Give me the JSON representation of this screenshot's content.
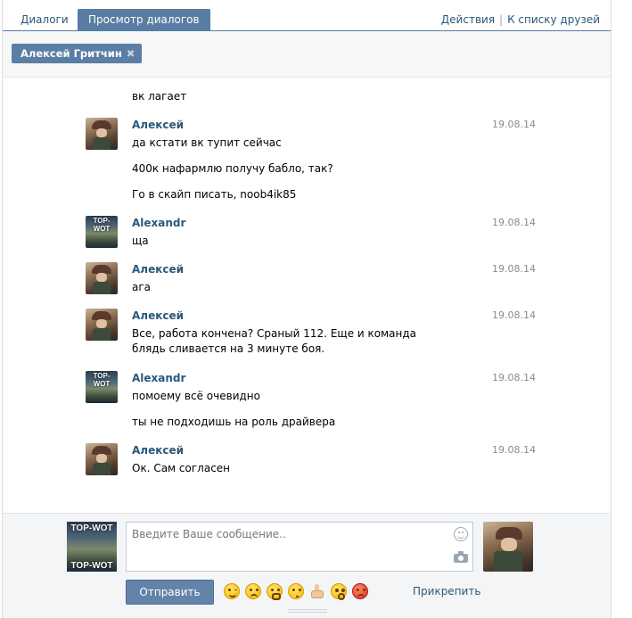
{
  "tabs": {
    "dialogs": "Диалоги",
    "view": "Просмотр диалогов"
  },
  "links": {
    "actions": "Действия",
    "separator": "|",
    "friends": "К списку друзей"
  },
  "filter": {
    "name": "Алексей Гритчин",
    "remove_icon": "✖"
  },
  "history": [
    {
      "author": "",
      "date": "",
      "avatar": "",
      "lines": [
        "вк лагает"
      ]
    },
    {
      "author": "Алексей",
      "date": "19.08.14",
      "avatar": "alexey",
      "lines": [
        "да кстати вк тупит сейчас",
        "400к нафармлю получу бабло, так?",
        "Го в скайп писать, noob4ik85"
      ]
    },
    {
      "author": "Alexandr",
      "date": "19.08.14",
      "avatar": "wot",
      "lines": [
        "ща"
      ]
    },
    {
      "author": "Алексей",
      "date": "19.08.14",
      "avatar": "alexey",
      "lines": [
        "ага"
      ]
    },
    {
      "author": "Алексей",
      "date": "19.08.14",
      "avatar": "alexey",
      "lines": [
        "Все, работа кончена? Сраный 112. Еще и команда блядь сливается на 3 минуте боя."
      ]
    },
    {
      "author": "Alexandr",
      "date": "19.08.14",
      "avatar": "wot",
      "lines": [
        "помоему всё очевидно",
        "ты не подходишь на роль драйвера"
      ]
    },
    {
      "author": "Алексей",
      "date": "19.08.14",
      "avatar": "alexey",
      "lines": [
        "Ок. Сам согласен"
      ]
    }
  ],
  "avatar_text": {
    "wot_top": "TOP-WOT",
    "wot_bottom": "TOP-WOT"
  },
  "composer": {
    "placeholder": "Введите Ваше сообщение..",
    "send_label": "Отправить",
    "attach_label": "Прикрепить",
    "emoji_icons": [
      "wink-emoji-icon",
      "crying-emoji-icon",
      "scared-emoji-icon",
      "kiss-emoji-icon",
      "thumbs-up-icon",
      "surprised-emoji-icon",
      "angry-emoji-icon"
    ]
  },
  "colors": {
    "accent": "#597da3",
    "link": "#2b587a",
    "send_button": "#6383a8"
  }
}
